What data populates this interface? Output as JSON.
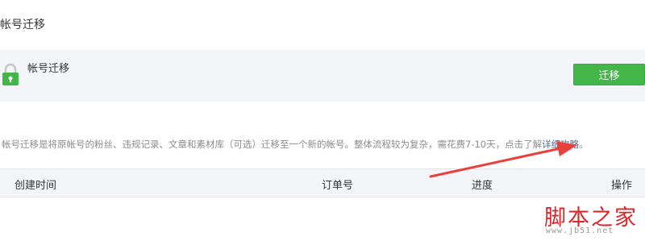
{
  "header": {
    "title": "帐号迁移"
  },
  "card": {
    "icon": "lock-icon",
    "title": "帐号迁移",
    "button_label": "迁移",
    "accent_color": "#44b549"
  },
  "description": {
    "text": "帐号迁移是将原帐号的粉丝、违规记录、文章和素材库（可选）迁移至一个新的帐号。整体流程较为复杂，需花费7-10天，点击了解",
    "link_text": "详细攻略",
    "suffix": "。"
  },
  "table": {
    "columns": [
      "创建时间",
      "订单号",
      "进度",
      "操作"
    ],
    "rows": []
  },
  "annotation": {
    "arrow_color": "#e8413b"
  },
  "watermark": {
    "main": "脚本之家",
    "sub": "www.jb51.net"
  }
}
